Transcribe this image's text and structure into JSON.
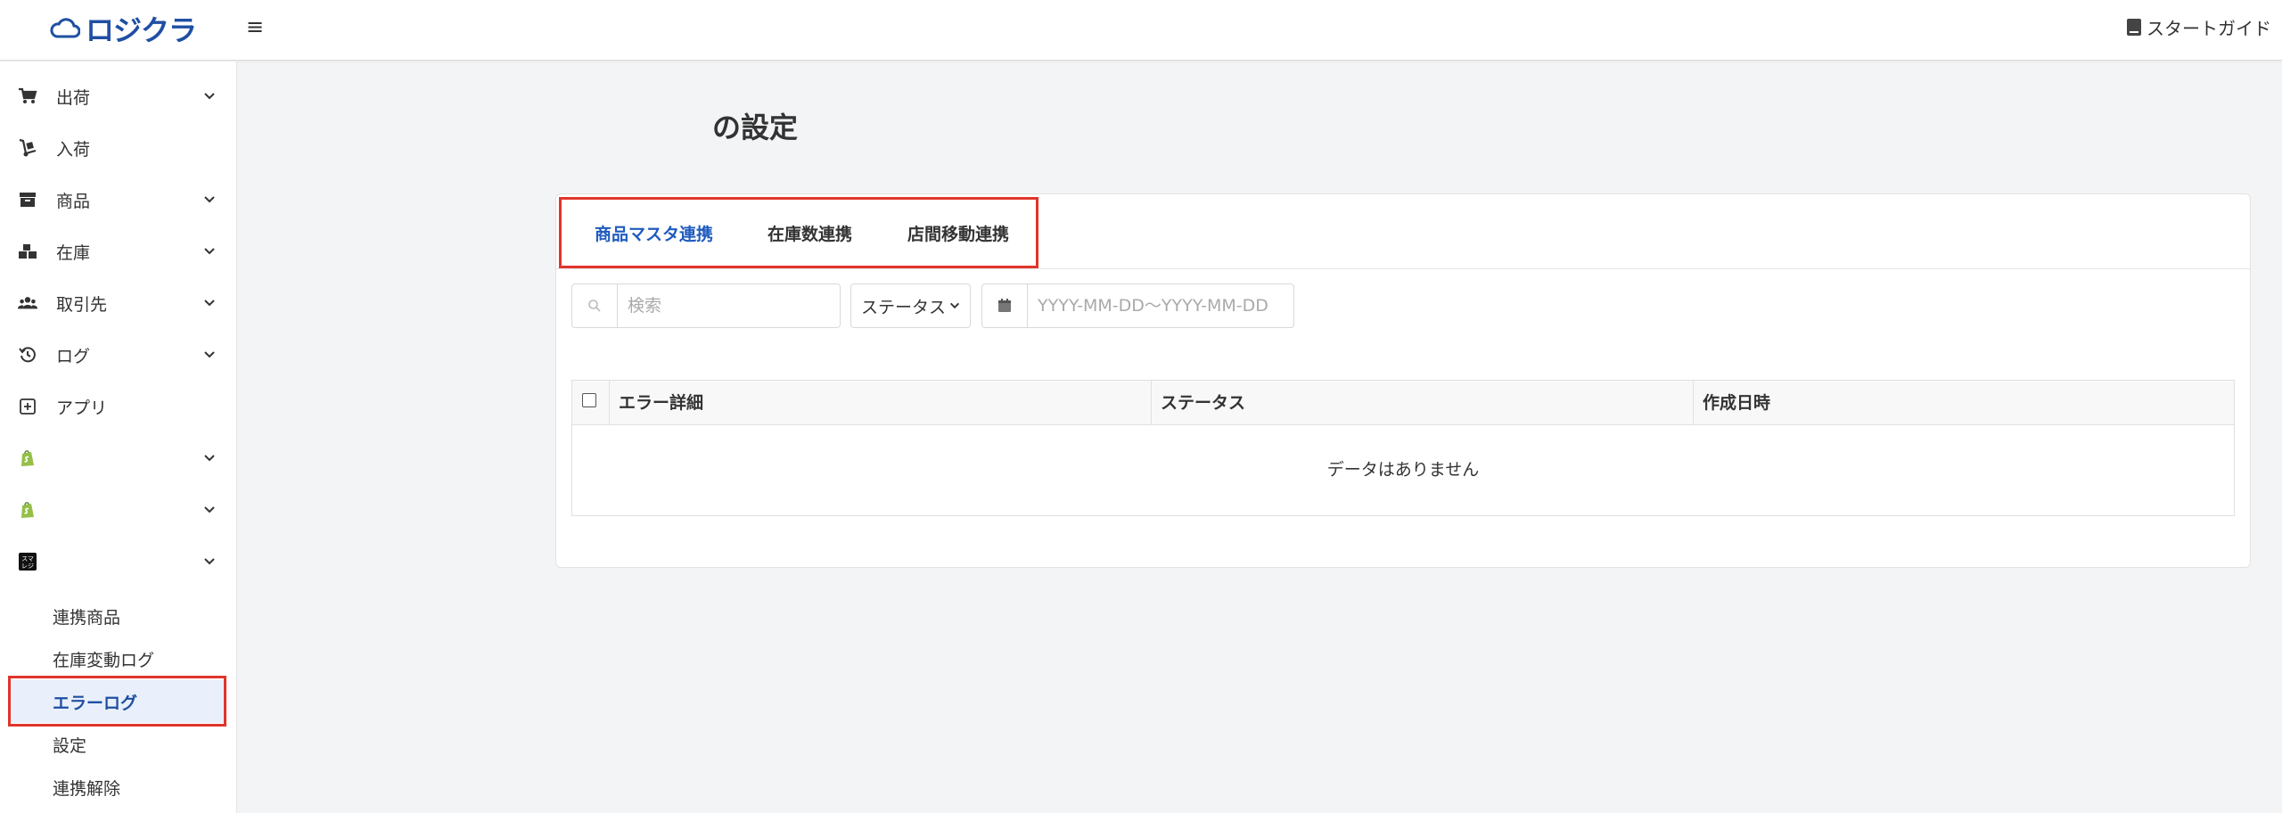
{
  "header": {
    "logo_text": "ロジクラ",
    "menu_icon": "hamburger-icon",
    "guide_label": "スタートガイド",
    "guide_icon": "book-icon"
  },
  "sidebar": {
    "items": [
      {
        "label": "出荷",
        "icon": "cart-icon",
        "expandable": true
      },
      {
        "label": "入荷",
        "icon": "hand-truck-icon",
        "expandable": false
      },
      {
        "label": "商品",
        "icon": "archive-box-icon",
        "expandable": true
      },
      {
        "label": "在庫",
        "icon": "boxes-icon",
        "expandable": true
      },
      {
        "label": "取引先",
        "icon": "users-icon",
        "expandable": true
      },
      {
        "label": "ログ",
        "icon": "history-icon",
        "expandable": true
      },
      {
        "label": "アプリ",
        "icon": "plus-square-icon",
        "expandable": false
      },
      {
        "label": "",
        "icon": "shopify-icon",
        "expandable": true
      },
      {
        "label": "",
        "icon": "shopify-icon",
        "expandable": true
      },
      {
        "label": "",
        "icon": "smaregi-icon",
        "expandable": true
      }
    ],
    "sub_items": [
      {
        "label": "連携商品",
        "active": false
      },
      {
        "label": "在庫変動ログ",
        "active": false
      },
      {
        "label": "エラーログ",
        "active": true
      },
      {
        "label": "設定",
        "active": false
      },
      {
        "label": "連携解除",
        "active": false
      }
    ],
    "smaregi_icon_text": "スマレジ"
  },
  "main": {
    "title": "の設定",
    "tabs": [
      {
        "label": "商品マスタ連携",
        "active": true
      },
      {
        "label": "在庫数連携",
        "active": false
      },
      {
        "label": "店間移動連携",
        "active": false
      }
    ],
    "search": {
      "placeholder": "検索",
      "icon": "search-icon"
    },
    "status_filter": {
      "label": "ステータス",
      "icon": "chevron-down-icon"
    },
    "date_range": {
      "placeholder": "YYYY-MM-DD〜YYYY-MM-DD",
      "icon": "calendar-icon"
    },
    "table": {
      "columns": [
        "エラー詳細",
        "ステータス",
        "作成日時"
      ],
      "empty_text": "データはありません"
    }
  },
  "colors": {
    "accent": "#1f5bbf",
    "highlight_border": "#e0352b",
    "active_bg": "#e9f0fb",
    "shopify_green": "#95bf47"
  }
}
